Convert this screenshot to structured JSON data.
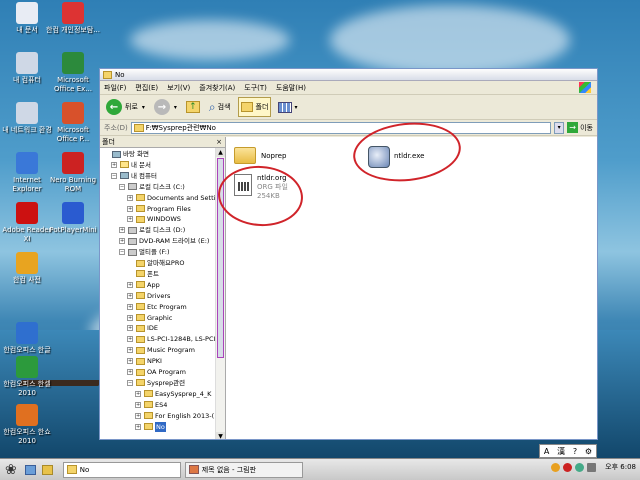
{
  "desktop": {
    "icons": [
      {
        "label": "내 문서",
        "icon": "my-documents-icon",
        "color": "#e8ecf4"
      },
      {
        "label": "한컴 개인정보탐...",
        "icon": "hancom-privacy-icon",
        "color": "#d33"
      },
      {
        "label": "내 컴퓨터",
        "icon": "my-computer-icon",
        "color": "#cfd8e6"
      },
      {
        "label": "Microsoft Office Ex...",
        "icon": "excel-icon",
        "color": "#2c8a3c"
      },
      {
        "label": "내 네트워크 환경",
        "icon": "network-icon",
        "color": "#cfd8e6"
      },
      {
        "label": "Microsoft Office P...",
        "icon": "powerpoint-icon",
        "color": "#d8512b"
      },
      {
        "label": "Internet Explorer",
        "icon": "ie-icon",
        "color": "#3a78d8"
      },
      {
        "label": "Nero Burning ROM",
        "icon": "nero-icon",
        "color": "#c22"
      },
      {
        "label": "Adobe Reader XI",
        "icon": "adobe-reader-icon",
        "color": "#c11"
      },
      {
        "label": "PotPlayerMini",
        "icon": "potplayer-icon",
        "color": "#2a5bd0"
      },
      {
        "label": "한컴 사전",
        "icon": "hancom-dictionary-icon",
        "color": "#e8a420"
      },
      {
        "label": "한컴오피스 한글 2010",
        "icon": "hwp-icon",
        "color": "#2f6fcf"
      },
      {
        "label": "한컴오피스 한셀 2010",
        "icon": "hancell-icon",
        "color": "#2c9a3c"
      },
      {
        "label": "한컴오피스 한쇼 2010",
        "icon": "hanshow-icon",
        "color": "#e07020"
      }
    ]
  },
  "window": {
    "title": "No",
    "menu": [
      "파일(F)",
      "편집(E)",
      "보기(V)",
      "즐겨찾기(A)",
      "도구(T)",
      "도움말(H)"
    ],
    "toolbar": {
      "back": "뒤로",
      "search": "검색",
      "folders": "폴더"
    },
    "address": {
      "label": "주소(D)",
      "value": "F:₩Sysprep관련₩No",
      "go": "이동"
    },
    "folder_pane": {
      "title": "폴더",
      "close": "×",
      "tree": [
        {
          "label": "바탕 화면",
          "depth": 0,
          "pm": "",
          "kind": "pc"
        },
        {
          "label": "내 문서",
          "depth": 1,
          "pm": "+",
          "kind": "doc"
        },
        {
          "label": "내 컴퓨터",
          "depth": 1,
          "pm": "−",
          "kind": "pc"
        },
        {
          "label": "로컬 디스크 (C:)",
          "depth": 2,
          "pm": "−",
          "kind": "drv"
        },
        {
          "label": "Documents and Settin",
          "depth": 3,
          "pm": "+",
          "kind": "fold"
        },
        {
          "label": "Program Files",
          "depth": 3,
          "pm": "+",
          "kind": "fold"
        },
        {
          "label": "WINDOWS",
          "depth": 3,
          "pm": "+",
          "kind": "fold"
        },
        {
          "label": "로컬 디스크 (D:)",
          "depth": 2,
          "pm": "+",
          "kind": "drv"
        },
        {
          "label": "DVD-RAM 드라이브 (E:)",
          "depth": 2,
          "pm": "+",
          "kind": "drv"
        },
        {
          "label": "멀티플 (F:)",
          "depth": 2,
          "pm": "−",
          "kind": "drv"
        },
        {
          "label": "알마해요PRO",
          "depth": 3,
          "pm": "",
          "kind": "fold"
        },
        {
          "label": "폰트",
          "depth": 3,
          "pm": "",
          "kind": "fold"
        },
        {
          "label": "App",
          "depth": 3,
          "pm": "+",
          "kind": "fold"
        },
        {
          "label": "Drivers",
          "depth": 3,
          "pm": "+",
          "kind": "fold"
        },
        {
          "label": "Etc Program",
          "depth": 3,
          "pm": "+",
          "kind": "fold"
        },
        {
          "label": "Graphic",
          "depth": 3,
          "pm": "+",
          "kind": "fold"
        },
        {
          "label": "IDE",
          "depth": 3,
          "pm": "+",
          "kind": "fold"
        },
        {
          "label": "LS-PCI-1284B, LS-PCI",
          "depth": 3,
          "pm": "+",
          "kind": "fold"
        },
        {
          "label": "Music Program",
          "depth": 3,
          "pm": "+",
          "kind": "fold"
        },
        {
          "label": "NPKI",
          "depth": 3,
          "pm": "+",
          "kind": "fold"
        },
        {
          "label": "OA Program",
          "depth": 3,
          "pm": "+",
          "kind": "fold"
        },
        {
          "label": "Sysprep관련",
          "depth": 3,
          "pm": "−",
          "kind": "fold"
        },
        {
          "label": "EasySysprep_4_K",
          "depth": 4,
          "pm": "+",
          "kind": "fold"
        },
        {
          "label": "ES4",
          "depth": 4,
          "pm": "+",
          "kind": "fold"
        },
        {
          "label": "For English 2013-(",
          "depth": 4,
          "pm": "+",
          "kind": "fold"
        },
        {
          "label": "No",
          "depth": 4,
          "pm": "+",
          "kind": "fold",
          "selected": true
        }
      ]
    },
    "files": [
      {
        "name": "Noprep",
        "type": "",
        "size": "",
        "kind": "folder"
      },
      {
        "name": "ntldr.exe",
        "type": "",
        "size": "",
        "kind": "exe"
      },
      {
        "name": "ntldr.org",
        "type": "ORG 파일",
        "size": "254KB",
        "kind": "doc"
      }
    ]
  },
  "ime": {
    "a": "A",
    "han": "漢",
    "qmark": "?",
    "gear": "⚙"
  },
  "taskbar": {
    "items": [
      {
        "label": "No",
        "active": true
      },
      {
        "label": "제목 없음 - 그림판",
        "active": false
      }
    ],
    "clock": "오후 6:08"
  },
  "colors": {
    "annotation": "#d0242a",
    "selection": "#316ac5"
  }
}
